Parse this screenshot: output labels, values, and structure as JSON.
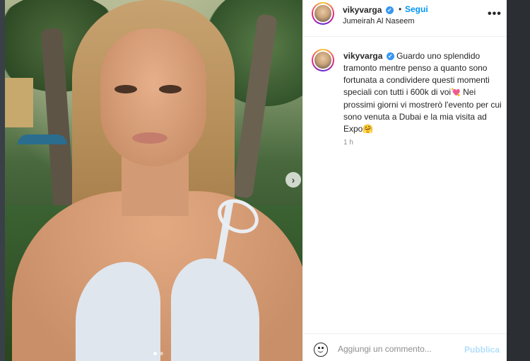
{
  "post": {
    "username": "vikyvarga",
    "follow_label": "Segui",
    "separator": "•",
    "location": "Jumeirah Al Naseem",
    "more_label": "•••",
    "caption_text": "Guardo uno splendido tramonto mentre penso a quanto sono fortunata a condividere questi momenti speciali con tutti i 600k di voi",
    "caption_text_2": " Nei prossimi giorni vi mostrerò l'evento per cui sono venuta a Dubai e la mia visita ad Expo",
    "heart_emoji": "💘",
    "smile_emoji": "🤗",
    "verified_icon": "verified-badge-icon",
    "time_ago": "1 h"
  },
  "carousel": {
    "next_label": "›",
    "slide_count": 2,
    "active_index": 0
  },
  "comment": {
    "placeholder": "Aggiungi un commento...",
    "publish_label": "Pubblica"
  },
  "colors": {
    "link_blue": "#0095f6",
    "publish_disabled": "#b2dffc",
    "verified_blue": "#3897f0"
  }
}
